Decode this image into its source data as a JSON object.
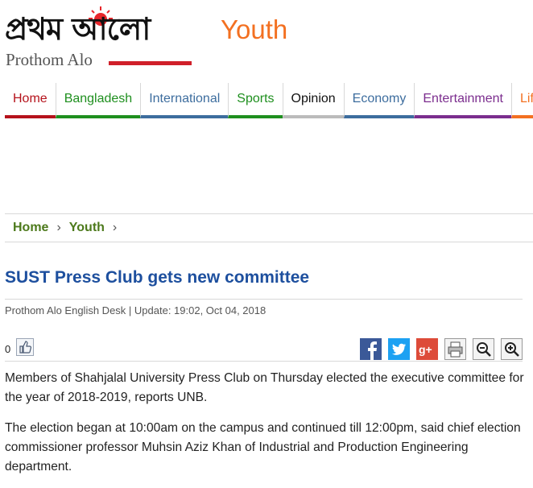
{
  "header": {
    "logo_bangla": "প্রথম আলো",
    "logo_english": "Prothom Alo",
    "section_title": "Youth",
    "colors": {
      "logo_red": "#d0202a",
      "section_orange": "#f37021"
    }
  },
  "nav": {
    "items": [
      {
        "label": "Home",
        "color": "#b5121b"
      },
      {
        "label": "Bangladesh",
        "color": "#1e8f1e"
      },
      {
        "label": "International",
        "color": "#3d6d9e"
      },
      {
        "label": "Sports",
        "color": "#1e8f1e"
      },
      {
        "label": "Opinion",
        "color": "#111111"
      },
      {
        "label": "Economy",
        "color": "#3d6d9e"
      },
      {
        "label": "Entertainment",
        "color": "#7b2d8e"
      },
      {
        "label": "Lif",
        "color": "#f37021"
      }
    ]
  },
  "breadcrumb": {
    "items": [
      "Home",
      "Youth"
    ],
    "separator": "›"
  },
  "article": {
    "headline": "SUST Press Club gets new committee",
    "byline": "Prothom Alo English Desk | Update: 19:02, Oct 04, 2018",
    "like_count": "0",
    "share_icons": [
      "facebook-icon",
      "twitter-icon",
      "google-plus-icon",
      "print-icon",
      "zoom-out-icon",
      "zoom-in-icon"
    ],
    "paragraphs": [
      "Members of Shahjalal University Press Club on Thursday elected the executive committee for the year of 2018-2019, reports UNB.",
      "The election began at 10:00am on the campus and continued till 12:00pm, said chief election commissioner professor Muhsin Aziz Khan of Industrial and Production Engineering department."
    ]
  }
}
